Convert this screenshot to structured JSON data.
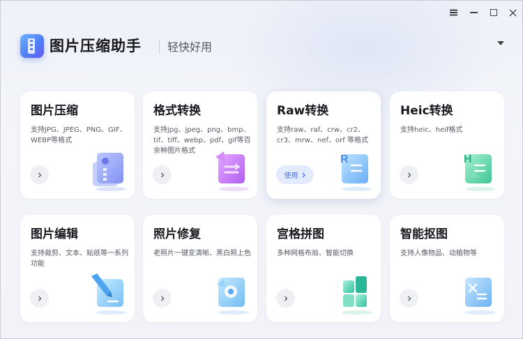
{
  "window": {
    "controls": [
      "menu-icon",
      "minimize-icon",
      "maximize-icon",
      "close-icon",
      "dropdown-icon"
    ]
  },
  "header": {
    "app_title": "图片压缩助手",
    "slogan": "轻快好用",
    "logo_icon": "zip-file-icon"
  },
  "colors": {
    "accent": "#3f6ef0",
    "pill_bg": "#e4ebfd",
    "card_bg": "#ffffff",
    "window_bg": "#f1f3f8"
  },
  "cards": [
    {
      "title": "图片压缩",
      "desc": "支持JPG、JPEG、PNG、GIF、WEBP等格式",
      "icon": "compress-file-icon",
      "button": "arrow"
    },
    {
      "title": "格式转换",
      "desc": "支持jpg、jpeg、png、bmp、tif、tiff、webp、pdf、gif等百余种图片格式",
      "icon": "convert-format-icon",
      "button": "arrow"
    },
    {
      "title": "Raw转换",
      "desc": "支持raw、raf、crw、cr2、cr3、mrw、nef、orf 等格式",
      "icon": "raw-convert-icon",
      "button": "pill",
      "button_label": "使用"
    },
    {
      "title": "Heic转换",
      "desc": "支持heic、heif格式",
      "icon": "heic-convert-icon",
      "button": "arrow"
    },
    {
      "title": "图片编辑",
      "desc": "支持裁剪、文本、贴纸等一系列功能",
      "icon": "edit-pen-icon",
      "button": "arrow"
    },
    {
      "title": "照片修复",
      "desc": "老照片一键变清晰、黑白照上色",
      "icon": "photo-repair-icon",
      "button": "arrow"
    },
    {
      "title": "宫格拼图",
      "desc": "多种网格布局、智能切换",
      "icon": "grid-puzzle-icon",
      "button": "arrow"
    },
    {
      "title": "智能抠图",
      "desc": "支持人像物品、动植物等",
      "icon": "smart-cutout-icon",
      "button": "arrow"
    }
  ]
}
